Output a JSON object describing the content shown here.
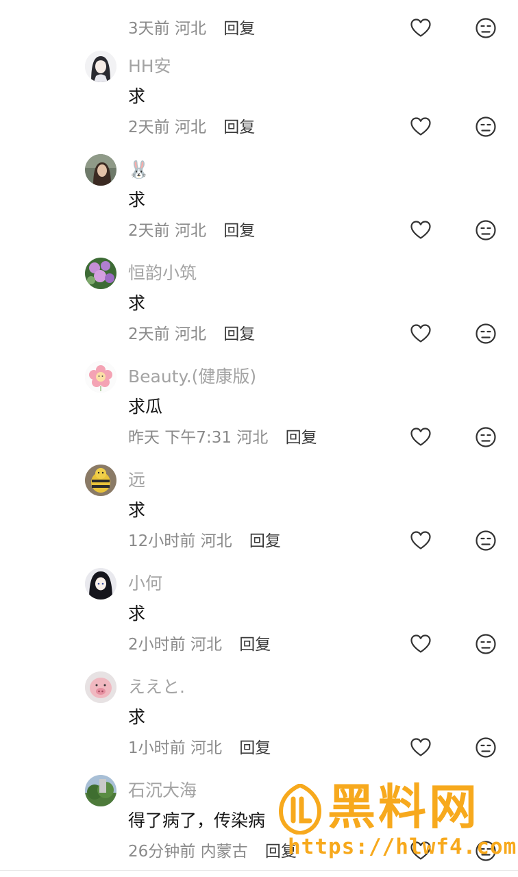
{
  "comments": [
    {
      "user": "",
      "text": "",
      "time": "3天前",
      "location": "河北",
      "reply_label": "回复",
      "avatar": "none"
    },
    {
      "user": "HH安",
      "text": "求",
      "time": "2天前",
      "location": "河北",
      "reply_label": "回复",
      "avatar": "anime-girl"
    },
    {
      "user": "🐰",
      "text": "求",
      "time": "2天前",
      "location": "河北",
      "reply_label": "回复",
      "avatar": "photo-girl"
    },
    {
      "user": "恒韵小筑",
      "text": "求",
      "time": "2天前",
      "location": "河北",
      "reply_label": "回复",
      "avatar": "flowers"
    },
    {
      "user": "Beauty.(健康版)",
      "text": "求瓜",
      "time": "昨天 下午7:31",
      "location": "河北",
      "reply_label": "回复",
      "avatar": "pink-flower"
    },
    {
      "user": "远",
      "text": "求",
      "time": "12小时前",
      "location": "河北",
      "reply_label": "回复",
      "avatar": "bee-toy"
    },
    {
      "user": "小何",
      "text": "求",
      "time": "2小时前",
      "location": "河北",
      "reply_label": "回复",
      "avatar": "anime-dark"
    },
    {
      "user": "ええと.",
      "text": "求",
      "time": "1小时前",
      "location": "河北",
      "reply_label": "回复",
      "avatar": "pig"
    },
    {
      "user": "石沉大海",
      "text": "得了病了，传染病",
      "time": "26分钟前",
      "location": "内蒙古",
      "reply_label": "回复",
      "avatar": "tree"
    }
  ],
  "icons": {
    "like": "heart-outline-icon",
    "dislike": "meh-face-icon"
  },
  "watermark": {
    "title": "黑料网",
    "url": "https://hlwf4.com",
    "color": "#f7a91d"
  }
}
